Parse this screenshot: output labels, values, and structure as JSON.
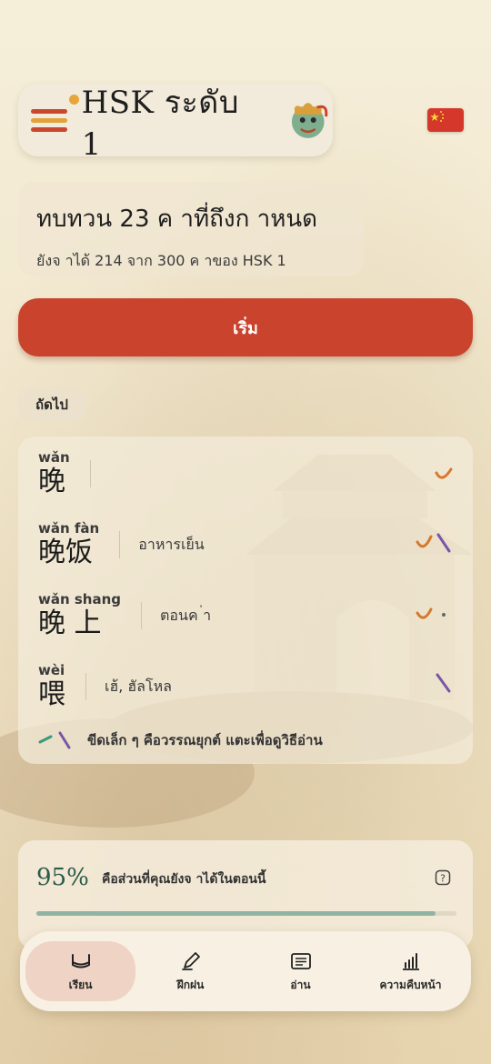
{
  "header": {
    "title": "HSK ระดับ 1",
    "menu_icon": "hamburger-menu-icon",
    "mascot_icon": "dragon-icon",
    "flag_icon": "china-flag-icon"
  },
  "progress": {
    "headline": "ทบทวน 23 ค  าที่ถึงก  าหนด",
    "subline": "ยังจ  าได้ 214 จาก 300 ค  าของ HSK 1"
  },
  "start_button": {
    "label": "เริ่ม"
  },
  "next_label": "ถัดไป",
  "words": [
    {
      "pinyin": "wǎn",
      "hanzi": "晚",
      "meaning": ""
    },
    {
      "pinyin": "wǎn fàn",
      "hanzi": "晚饭",
      "meaning": "อาหารเย็น"
    },
    {
      "pinyin": "wǎn shang",
      "hanzi": "晚 上",
      "meaning": "ตอนค  ่า"
    },
    {
      "pinyin": "wèi",
      "hanzi": "喂",
      "meaning": "เฮ้, ฮัลโหล"
    }
  ],
  "legend": {
    "text": "ขีดเล็ก ๆ คือวรรณยุกต์ แตะเพื่อดูวิธีอ่าน"
  },
  "retention": {
    "percent": "95%",
    "text": "คือส่วนที่คุณยังจ  าได้ในตอนนี้",
    "fill_fraction": 0.95,
    "help_icon": "question-icon"
  },
  "nav": [
    {
      "label": "เรียน",
      "icon": "learn-icon",
      "active": true
    },
    {
      "label": "ฝึกฝน",
      "icon": "pencil-icon",
      "active": false
    },
    {
      "label": "อ่าน",
      "icon": "reading-icon",
      "active": false
    },
    {
      "label": "ความคืบหน้า",
      "icon": "chart-icon",
      "active": false
    }
  ],
  "colors": {
    "accent": "#c9432d",
    "tone_orange": "#d9782a",
    "tone_purple": "#7a55a8",
    "tone_green": "#3a9a7a",
    "stat_green": "#2c5c4a"
  }
}
